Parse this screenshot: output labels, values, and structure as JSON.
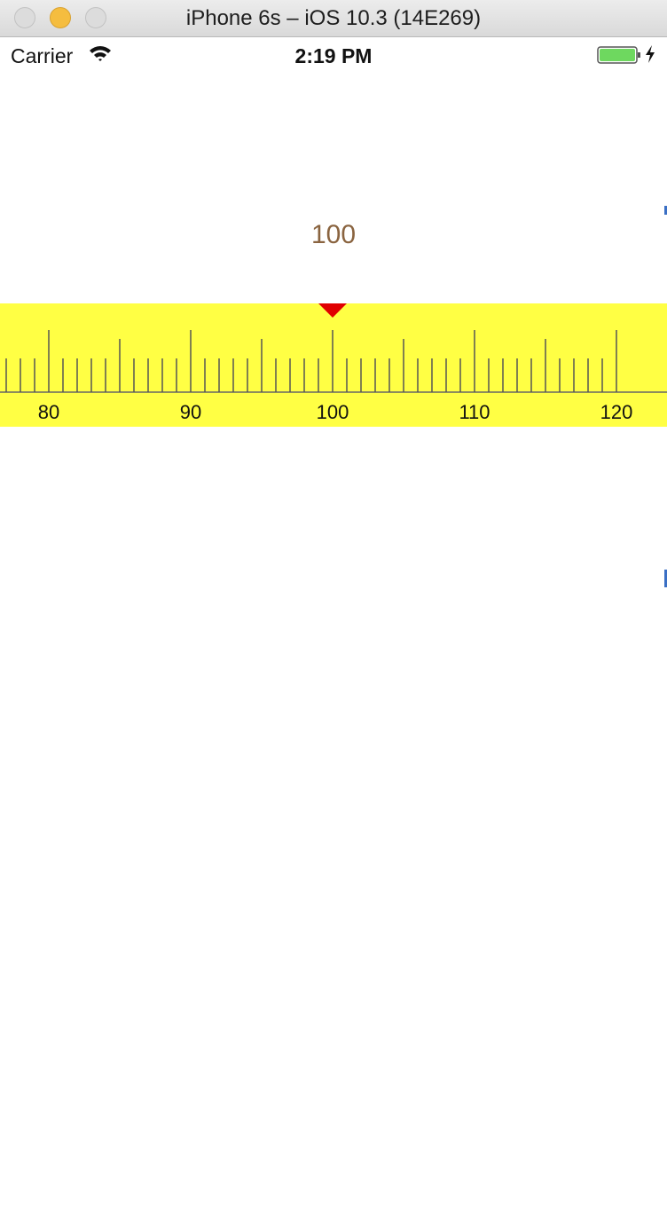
{
  "window": {
    "title": "iPhone 6s – iOS 10.3 (14E269)"
  },
  "status_bar": {
    "carrier": "Carrier",
    "time": "2:19 PM"
  },
  "ruler": {
    "selected_value": "100",
    "min_visible": 73,
    "max_visible": 120,
    "labels": [
      "80",
      "90",
      "100",
      "110",
      "120"
    ],
    "indicator_color": "#e00000",
    "background": "#ffff44"
  }
}
